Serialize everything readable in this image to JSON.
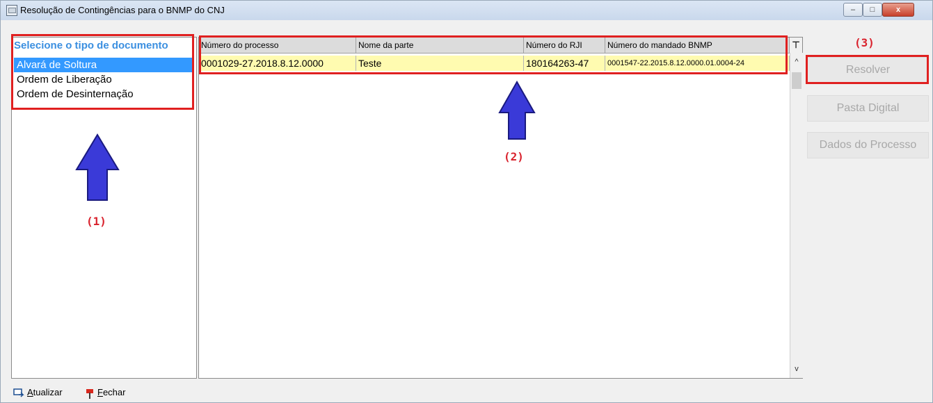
{
  "window": {
    "title": "Resolução de Contingências para o BNMP do CNJ",
    "buttons": {
      "minimize": "–",
      "maximize": "□",
      "close": "x"
    }
  },
  "left_panel": {
    "heading": "Selecione o tipo de documento",
    "items": [
      "Alvará de Soltura",
      "Ordem de Liberação",
      "Ordem de Desinternação"
    ],
    "selected_index": 0
  },
  "grid": {
    "columns": [
      "Número do processo",
      "Nome da parte",
      "Número do RJI",
      "Número do mandado BNMP"
    ],
    "filter_icon": "funnel-icon",
    "rows": [
      [
        "0001029-27.2018.8.12.0000",
        "Teste",
        "180164263-47",
        "0001547-22.2015.8.12.0000.01.0004-24"
      ]
    ]
  },
  "side_buttons": {
    "resolver": "Resolver",
    "pasta_digital": "Pasta Digital",
    "dados_processo": "Dados do Processo"
  },
  "toolbar": {
    "refresh": {
      "accel": "A",
      "rest": "tualizar"
    },
    "close": {
      "accel": "F",
      "rest": "echar"
    }
  },
  "annotations": {
    "one": "(1)",
    "two": "(2)",
    "three": "(3)"
  },
  "colors": {
    "heading_blue": "#3b8fe0",
    "selection_blue": "#3399ff",
    "row_highlight": "#fffbb0",
    "annotation_red": "#e02020",
    "arrow_blue": "#3a3ad8"
  }
}
